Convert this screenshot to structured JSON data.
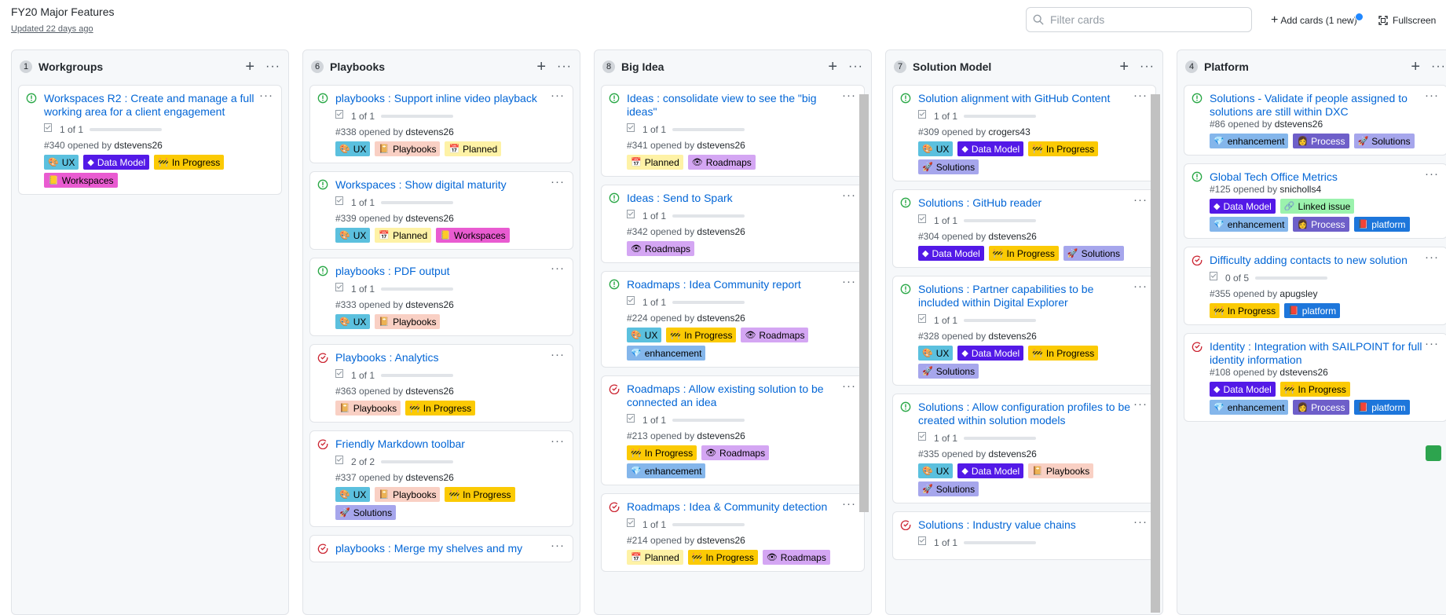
{
  "header": {
    "title": "FY20 Major Features",
    "updated": "Updated 22 days ago"
  },
  "toolbar": {
    "filter_placeholder": "Filter cards",
    "add_cards": "Add cards (1 new)",
    "fullscreen": "Fullscreen"
  },
  "colors": {
    "accent": "#0366d6",
    "open_issue": "#28a745",
    "closed_issue": "#cb2431",
    "column_bg": "#f6f8fa"
  },
  "labels": {
    "ux": {
      "text": "UX",
      "icon": "palette-icon",
      "bg": "#5bc0de",
      "fg": "#000000"
    },
    "data_model": {
      "text": "Data Model",
      "icon": "diamond-icon",
      "bg": "#5319e7",
      "fg": "#ffffff"
    },
    "in_progress": {
      "text": "In Progress",
      "icon": "construction-icon",
      "bg": "#fbca04",
      "fg": "#000000"
    },
    "workspaces": {
      "text": "Workspaces",
      "icon": "folder-icon",
      "bg": "#e95bd1",
      "fg": "#000000"
    },
    "playbooks": {
      "text": "Playbooks",
      "icon": "book-icon",
      "bg": "#f9d0c4",
      "fg": "#000000"
    },
    "planned": {
      "text": "Planned",
      "icon": "calendar-icon",
      "bg": "#fef2a6",
      "fg": "#000000"
    },
    "roadmaps": {
      "text": "Roadmaps",
      "icon": "eye-icon",
      "bg": "#d4a6f3",
      "fg": "#000000"
    },
    "enhancement": {
      "text": "enhancement",
      "icon": "gem-icon",
      "bg": "#84b6eb",
      "fg": "#000000"
    },
    "solutions": {
      "text": "Solutions",
      "icon": "rocket-icon",
      "bg": "#a6a6ec",
      "fg": "#000000"
    },
    "process": {
      "text": "Process",
      "icon": "person-icon",
      "bg": "#6e5fc9",
      "fg": "#ffffff"
    },
    "linked_issue": {
      "text": "Linked issue",
      "icon": "link-icon",
      "bg": "#9bf2ad",
      "fg": "#000000"
    },
    "platform": {
      "text": "platform",
      "icon": "box-icon",
      "bg": "#1d76db",
      "fg": "#ffffff"
    }
  },
  "columns": [
    {
      "count": "1",
      "name": "Workgroups",
      "plus": "+",
      "menu": "···",
      "cards": [
        {
          "state": "open",
          "title": "Workspaces R2 : Create and manage a full working area for a client engagement",
          "progress": "1 of 1",
          "done": 1,
          "meta_prefix": "#340 opened by ",
          "author": "dstevens26",
          "labels": [
            "ux",
            "data_model",
            "in_progress",
            "workspaces"
          ]
        }
      ]
    },
    {
      "count": "6",
      "name": "Playbooks",
      "plus": "+",
      "menu": "···",
      "cards": [
        {
          "state": "open",
          "title": "playbooks : Support inline video playback",
          "progress": "1 of 1",
          "done": 1,
          "meta_prefix": "#338 opened by ",
          "author": "dstevens26",
          "labels": [
            "ux",
            "playbooks",
            "planned"
          ]
        },
        {
          "state": "open",
          "title": "Workspaces : Show digital maturity",
          "progress": "1 of 1",
          "done": 1,
          "meta_prefix": "#339 opened by ",
          "author": "dstevens26",
          "labels": [
            "ux",
            "planned",
            "workspaces"
          ]
        },
        {
          "state": "open",
          "title": "playbooks : PDF output",
          "progress": "1 of 1",
          "done": 1,
          "meta_prefix": "#333 opened by ",
          "author": "dstevens26",
          "labels": [
            "ux",
            "playbooks"
          ]
        },
        {
          "state": "closed",
          "title": "Playbooks : Analytics",
          "progress": "1 of 1",
          "done": 1,
          "meta_prefix": "#363 opened by ",
          "author": "dstevens26",
          "labels": [
            "playbooks",
            "in_progress"
          ]
        },
        {
          "state": "closed",
          "title": "Friendly Markdown toolbar",
          "progress": "2 of 2",
          "done": 1,
          "meta_prefix": "#337 opened by ",
          "author": "dstevens26",
          "labels": [
            "ux",
            "playbooks",
            "in_progress",
            "solutions"
          ]
        },
        {
          "state": "closed",
          "title": "playbooks : Merge my shelves and my",
          "progress": "",
          "done": 0,
          "meta_prefix": "",
          "author": "",
          "labels": []
        }
      ]
    },
    {
      "count": "8",
      "name": "Big Idea",
      "plus": "+",
      "menu": "···",
      "cards": [
        {
          "state": "open",
          "title": "Ideas : consolidate view to see the \"big ideas\"",
          "progress": "1 of 1",
          "done": 1,
          "meta_prefix": "#341 opened by ",
          "author": "dstevens26",
          "labels": [
            "planned",
            "roadmaps"
          ]
        },
        {
          "state": "open",
          "title": "Ideas : Send to Spark",
          "progress": "1 of 1",
          "done": 1,
          "meta_prefix": "#342 opened by ",
          "author": "dstevens26",
          "labels": [
            "roadmaps"
          ]
        },
        {
          "state": "open",
          "title": "Roadmaps : Idea Community report",
          "progress": "1 of 1",
          "done": 1,
          "meta_prefix": "#224 opened by ",
          "author": "dstevens26",
          "labels": [
            "ux",
            "in_progress",
            "roadmaps",
            "enhancement"
          ]
        },
        {
          "state": "closed",
          "title": "Roadmaps : Allow existing solution to be connected an idea",
          "progress": "1 of 1",
          "done": 1,
          "meta_prefix": "#213 opened by ",
          "author": "dstevens26",
          "labels": [
            "in_progress",
            "roadmaps",
            "enhancement"
          ]
        },
        {
          "state": "closed",
          "title": "Roadmaps : Idea & Community detection",
          "progress": "1 of 1",
          "done": 1,
          "meta_prefix": "#214 opened by ",
          "author": "dstevens26",
          "labels": [
            "planned",
            "in_progress",
            "roadmaps"
          ]
        }
      ]
    },
    {
      "count": "7",
      "name": "Solution Model",
      "plus": "+",
      "menu": "···",
      "cards": [
        {
          "state": "open",
          "title": "Solution alignment with GitHub Content",
          "progress": "1 of 1",
          "done": 1,
          "meta_prefix": "#309 opened by ",
          "author": "crogers43",
          "labels": [
            "ux",
            "data_model",
            "in_progress",
            "solutions"
          ]
        },
        {
          "state": "open",
          "title": "Solutions : GitHub reader",
          "progress": "1 of 1",
          "done": 1,
          "meta_prefix": "#304 opened by ",
          "author": "dstevens26",
          "labels": [
            "data_model",
            "in_progress",
            "solutions"
          ]
        },
        {
          "state": "open",
          "title": "Solutions : Partner capabilities to be included within Digital Explorer",
          "progress": "1 of 1",
          "done": 1,
          "meta_prefix": "#328 opened by ",
          "author": "dstevens26",
          "labels": [
            "ux",
            "data_model",
            "in_progress",
            "solutions"
          ]
        },
        {
          "state": "open",
          "title": "Solutions : Allow configuration profiles to be created within solution models",
          "progress": "1 of 1",
          "done": 1,
          "meta_prefix": "#335 opened by ",
          "author": "dstevens26",
          "labels": [
            "ux",
            "data_model",
            "playbooks",
            "solutions"
          ]
        },
        {
          "state": "closed",
          "title": "Solutions : Industry value chains",
          "progress": "1 of 1",
          "done": 1,
          "meta_prefix": "",
          "author": "",
          "labels": []
        }
      ]
    },
    {
      "count": "4",
      "name": "Platform",
      "plus": "+",
      "menu": "···",
      "cards": [
        {
          "state": "open",
          "title": "Solutions - Validate if people assigned to solutions are still within DXC",
          "progress": "",
          "done": 0,
          "meta_prefix": "#86 opened by ",
          "author": "dstevens26",
          "labels": [
            "enhancement",
            "process",
            "solutions"
          ]
        },
        {
          "state": "open",
          "title": "Global Tech Office Metrics",
          "progress": "",
          "done": 0,
          "meta_prefix": "#125 opened by ",
          "author": "snicholls4",
          "labels": [
            "data_model",
            "linked_issue",
            "enhancement",
            "process",
            "platform"
          ]
        },
        {
          "state": "closed",
          "title": "Difficulty adding contacts to new solution",
          "progress": "0 of 5",
          "done": 0,
          "meta_prefix": "#355 opened by ",
          "author": "apugsley",
          "labels": [
            "in_progress",
            "platform"
          ]
        },
        {
          "state": "closed",
          "title": "Identity : Integration with SAILPOINT for full identity information",
          "progress": "",
          "done": 0,
          "meta_prefix": "#108 opened by ",
          "author": "dstevens26",
          "labels": [
            "data_model",
            "in_progress",
            "enhancement",
            "process",
            "platform"
          ]
        }
      ]
    }
  ]
}
